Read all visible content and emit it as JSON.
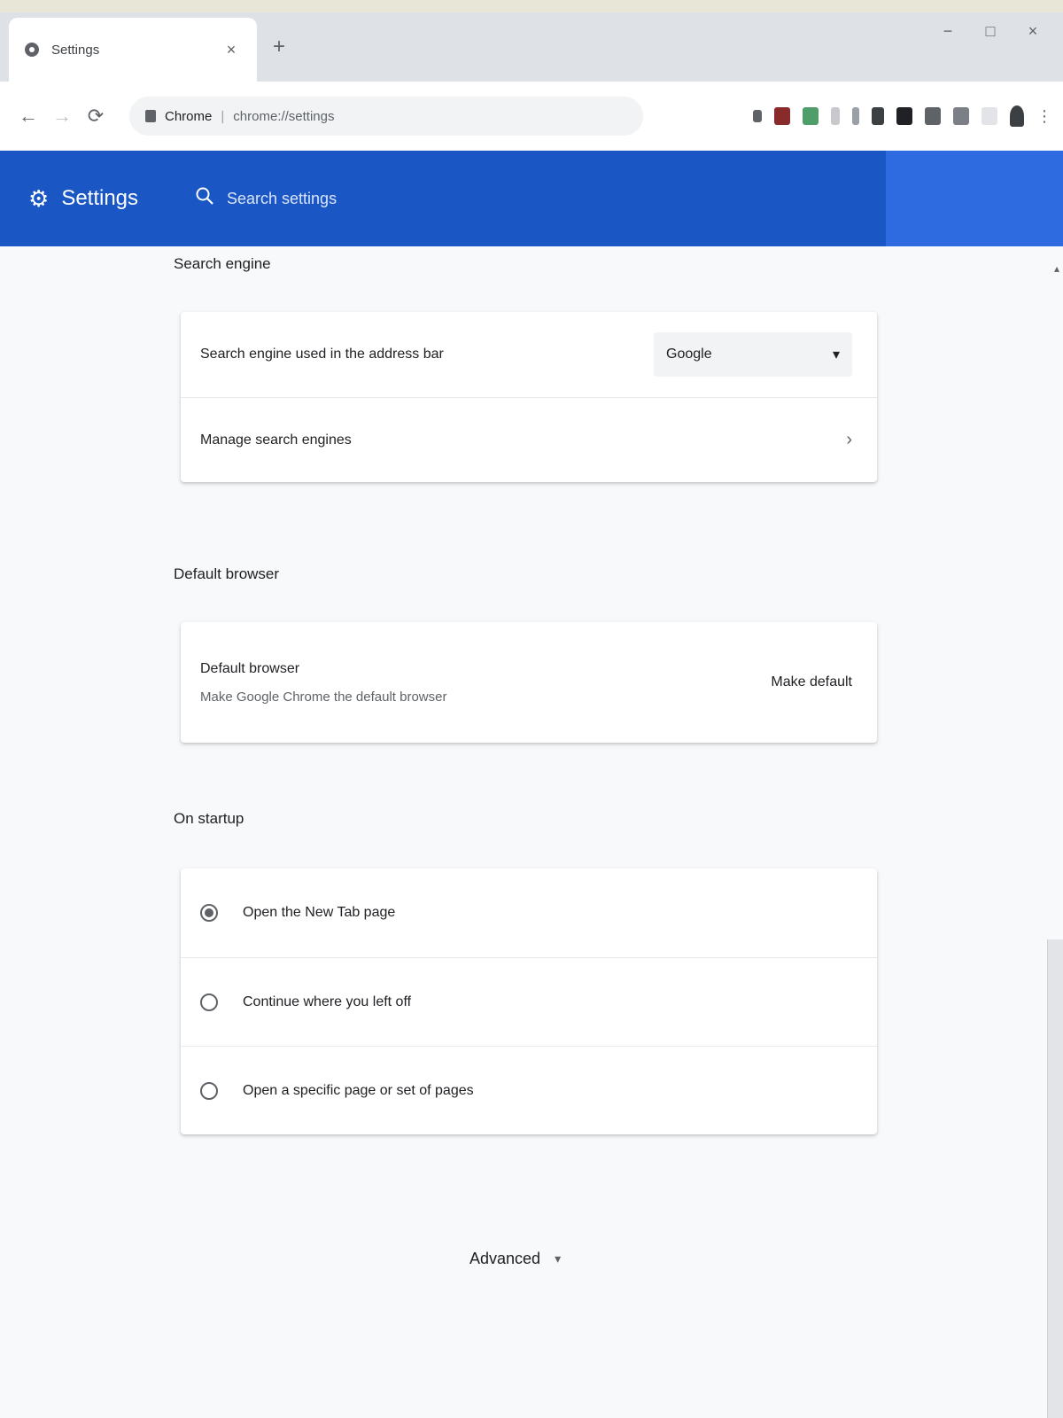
{
  "browser": {
    "tab_title": "Settings",
    "tab_close": "×",
    "new_tab": "+",
    "window_controls": [
      "−",
      "□",
      "×"
    ],
    "nav": {
      "back": "←",
      "forward": "→",
      "reload": "⟳"
    },
    "omnibox": {
      "origin": "Chrome",
      "separator": "|",
      "path": "chrome://settings"
    }
  },
  "header": {
    "title": "Settings",
    "search_placeholder": "Search settings"
  },
  "search_engine": {
    "title": "Search engine",
    "engine_row_label": "Search engine used in the address bar",
    "engine_selected": "Google",
    "manage_label": "Manage search engines"
  },
  "default_browser": {
    "title": "Default browser",
    "row_title": "Default browser",
    "row_subtitle": "Make Google Chrome the default browser",
    "make_default_label": "Make default"
  },
  "on_startup": {
    "title": "On startup",
    "options": [
      {
        "label": "Open the New Tab page",
        "checked": true
      },
      {
        "label": "Continue where you left off",
        "checked": false
      },
      {
        "label": "Open a specific page or set of pages",
        "checked": false
      }
    ]
  },
  "advanced": {
    "label": "Advanced"
  },
  "icons": {
    "gear": "⚙",
    "search": "🔍",
    "dropdown": "▾",
    "chevron_right": "›",
    "caret_down": "▾"
  }
}
